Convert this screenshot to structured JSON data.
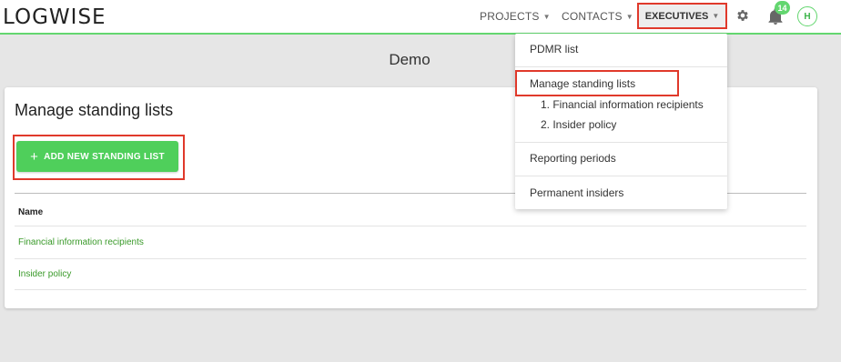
{
  "header": {
    "logo": "LOGWISE",
    "nav": {
      "projects": "PROJECTS",
      "contacts": "CONTACTS",
      "executives": "EXECUTIVES"
    },
    "notifications_count": "14",
    "avatar_initial": "H"
  },
  "page": {
    "title": "Demo"
  },
  "card": {
    "title": "Manage standing lists",
    "add_button_label": "ADD NEW STANDING LIST",
    "column_name": "Name",
    "rows": [
      "Financial information recipients",
      "Insider policy"
    ]
  },
  "dropdown": {
    "pdmr_list": "PDMR list",
    "manage_standing_lists": "Manage standing lists",
    "sub_items": [
      "1. Financial information recipients",
      "2. Insider policy"
    ],
    "reporting_periods": "Reporting periods",
    "permanent_insiders": "Permanent insiders"
  },
  "colors": {
    "accent_green": "#63d66f",
    "button_green": "#4fcf5b",
    "highlight_red": "#e0392b",
    "link_green": "#3a9a2a"
  },
  "icons": {
    "settings": "gear-icon",
    "notifications": "bell-icon",
    "add": "plus-icon",
    "dropdown_caret": "caret-down-icon"
  }
}
